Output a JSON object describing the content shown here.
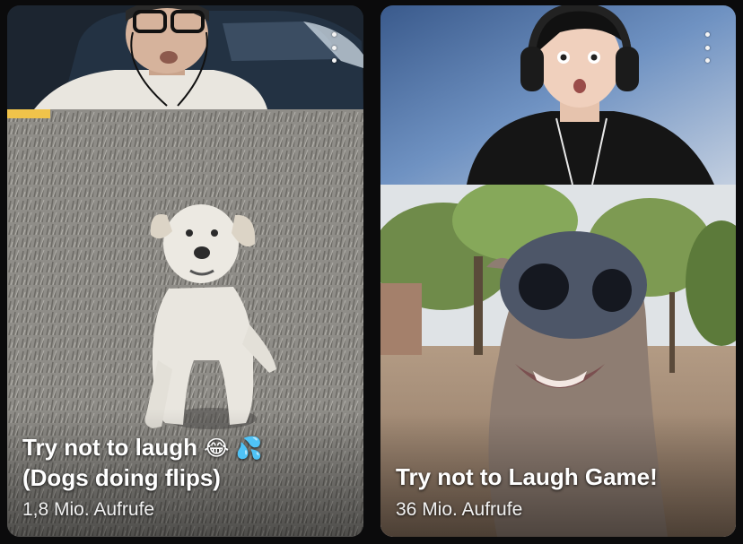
{
  "videos": [
    {
      "title_line1": "Try not to laugh",
      "title_emoji": "😂 💦",
      "title_line2": "(Dogs doing flips)",
      "views": "1,8 Mio. Aufrufe"
    },
    {
      "title": "Try not to Laugh Game!",
      "views": "36 Mio. Aufrufe"
    }
  ],
  "icons": {
    "menu": "more-vert-icon"
  },
  "colors": {
    "background": "#0b0b0c",
    "text": "#ffffff"
  }
}
